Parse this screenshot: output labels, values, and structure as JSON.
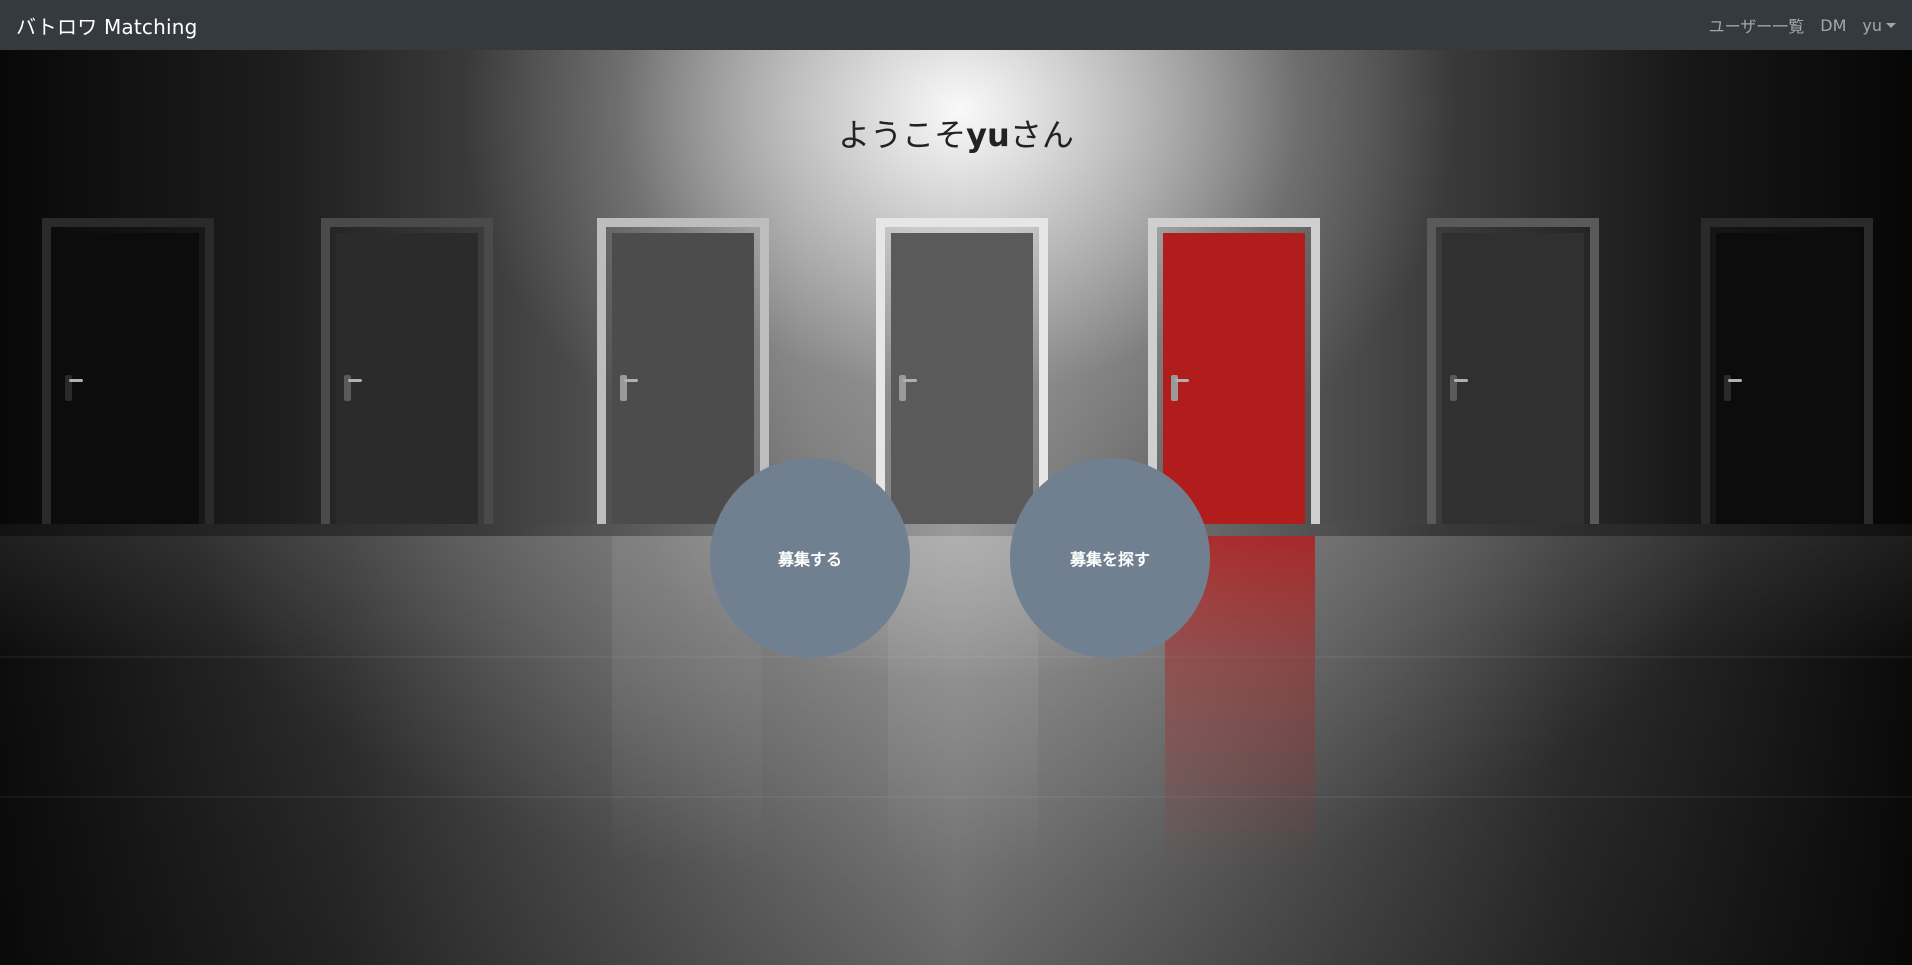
{
  "navbar": {
    "brand": "バトロワ Matching",
    "links": {
      "users": "ユーザー一覧",
      "dm": "DM",
      "user_menu": "yu"
    }
  },
  "main": {
    "welcome_prefix": "ようこそ",
    "username": "yu",
    "welcome_suffix": "さん",
    "buttons": {
      "recruit": "募集する",
      "search_recruit": "募集を探す"
    }
  },
  "colors": {
    "navbar_bg": "#343a40",
    "button_bg": "#708090",
    "accent_door": "#b11c1c"
  }
}
